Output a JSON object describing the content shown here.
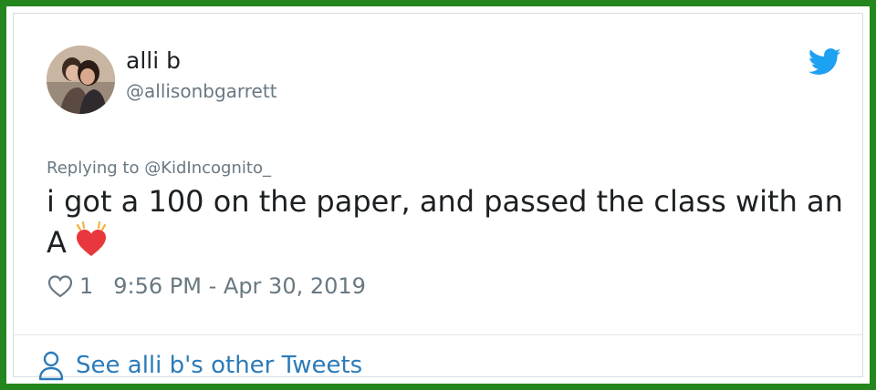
{
  "user": {
    "display_name": "alli b",
    "handle": "@allisonbgarrett"
  },
  "tweet": {
    "replying_to": "Replying to @KidIncognito_",
    "text": "i got a 100 on the paper, and passed the class with an A",
    "emoji": "beating-heart",
    "like_count": "1",
    "timestamp": "9:56 PM - Apr 30, 2019"
  },
  "footer": {
    "link_label": "See alli b's other Tweets"
  },
  "icons": {
    "brand": "twitter-bird-icon",
    "like": "heart-outline-icon",
    "profile": "person-icon"
  },
  "colors": {
    "frame_border": "#24861c",
    "twitter_blue": "#1da1f2",
    "link_blue": "#2b7bb9",
    "muted_text": "#697882",
    "body_text": "#1c2022",
    "emoji_red": "#e8383d"
  }
}
